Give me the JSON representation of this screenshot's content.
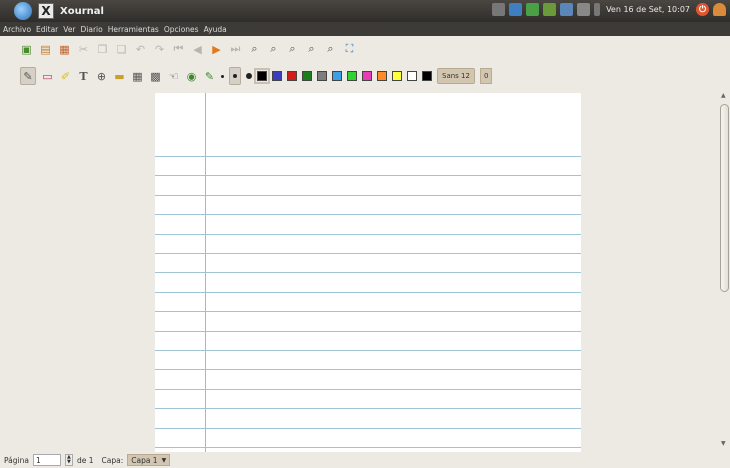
{
  "window": {
    "title": "Xournal"
  },
  "tray": {
    "clock": "Ven 16 de Set, 10:07"
  },
  "menu": [
    "Archivo",
    "Editar",
    "Ver",
    "Diario",
    "Herramientas",
    "Opciones",
    "Ayuda"
  ],
  "toolbar1": {
    "icons": [
      "new-icon",
      "open-icon",
      "save-icon",
      "cut-icon",
      "copy-icon",
      "paste-icon",
      "undo-icon",
      "redo-icon",
      "first-page-icon",
      "prev-page-icon",
      "next-page-icon",
      "last-page-icon",
      "zoom-out-icon",
      "zoom-in-icon",
      "zoom-fit-icon",
      "zoom-100-icon",
      "zoom-page-icon",
      "fullscreen-icon"
    ]
  },
  "toolbar2": {
    "colors": [
      "#000000",
      "#3c3cbe",
      "#d41b1b",
      "#1b7d1b",
      "#7d7d7d",
      "#3ca0e6",
      "#32d232",
      "#e63cb4",
      "#ff8c28",
      "#ffff3c",
      "#ffffff",
      "#000000"
    ],
    "font_label": "Sans 12",
    "font_size_label": "0"
  },
  "status": {
    "page_label": "Página",
    "page_value": "1",
    "of_label": "de 1",
    "layer_label": "Capa:",
    "layer_value": "Capa 1"
  },
  "colors": {
    "page_rule": "#9fc4d6",
    "page_margin": "#e59ab8",
    "panel_dark": "#3c3b37"
  }
}
